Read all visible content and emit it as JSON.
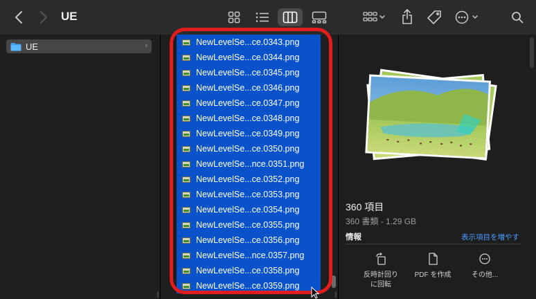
{
  "window": {
    "title": "UE"
  },
  "toolbar": {
    "back_icon": "chevron-left-icon",
    "forward_icon": "chevron-right-icon",
    "views": [
      "icon-view-icon",
      "list-view-icon",
      "column-view-icon",
      "gallery-view-icon"
    ],
    "active_view": "column-view-icon",
    "group_icon": "group-grid-icon",
    "share_icon": "share-icon",
    "tag_icon": "tag-icon",
    "more_icon": "ellipsis-circle-icon",
    "search_icon": "search-icon"
  },
  "sidebar_column": {
    "items": [
      {
        "label": "UE",
        "icon": "folder-icon",
        "selected": true
      }
    ]
  },
  "files": [
    "NewLevelSe...ce.0343.png",
    "NewLevelSe...ce.0344.png",
    "NewLevelSe...ce.0345.png",
    "NewLevelSe...ce.0346.png",
    "NewLevelSe...ce.0347.png",
    "NewLevelSe...ce.0348.png",
    "NewLevelSe...ce.0349.png",
    "NewLevelSe...ce.0350.png",
    "NewLevelSe...nce.0351.png",
    "NewLevelSe...ce.0352.png",
    "NewLevelSe...ce.0353.png",
    "NewLevelSe...ce.0354.png",
    "NewLevelSe...ce.0355.png",
    "NewLevelSe...ce.0356.png",
    "NewLevelSe...nce.0357.png",
    "NewLevelSe...ce.0358.png",
    "NewLevelSe...ce.0359.png"
  ],
  "preview": {
    "count_label": "360 項目",
    "sub_label": "360 書類 - 1.29 GB",
    "info_label": "情報",
    "show_more_label": "表示項目を増やす",
    "actions": [
      {
        "label": "反時計回り\nに回転",
        "icon": "rotate-left-icon"
      },
      {
        "label": "PDF を作成",
        "icon": "document-icon"
      },
      {
        "label": "その他...",
        "icon": "ellipsis-circle-icon"
      }
    ]
  },
  "colors": {
    "selection": "#0a52c9",
    "highlight": "#e21d1d",
    "link": "#4a9bff"
  }
}
